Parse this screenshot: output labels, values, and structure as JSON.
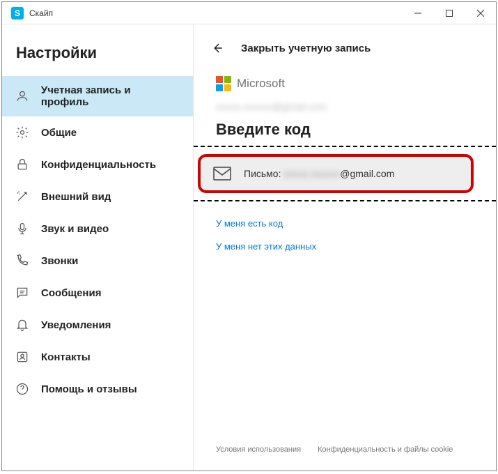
{
  "app": {
    "icon_letter": "S",
    "title": "Скайп"
  },
  "sidebar": {
    "title": "Настройки",
    "items": [
      {
        "label": "Учетная запись и профиль"
      },
      {
        "label": "Общие"
      },
      {
        "label": "Конфиденциальность"
      },
      {
        "label": "Внешний вид"
      },
      {
        "label": "Звук и видео"
      },
      {
        "label": "Звонки"
      },
      {
        "label": "Сообщения"
      },
      {
        "label": "Уведомления"
      },
      {
        "label": "Контакты"
      },
      {
        "label": "Помощь и отзывы"
      }
    ]
  },
  "main": {
    "header_title": "Закрыть учетную запись",
    "ms_brand": "Microsoft",
    "account_email": "xxxxx.xxxxxx@gmail.com",
    "enter_code_title": "Введите код",
    "email_option_prefix": "Письмо: ",
    "email_option_blur": "xxxxx.xxxxxx",
    "email_option_suffix": "@gmail.com",
    "link_have_code": "У меня есть код",
    "link_no_data": "У меня нет этих данных"
  },
  "footer": {
    "terms": "Условия использования",
    "privacy": "Конфиденциальность и файлы cookie"
  }
}
